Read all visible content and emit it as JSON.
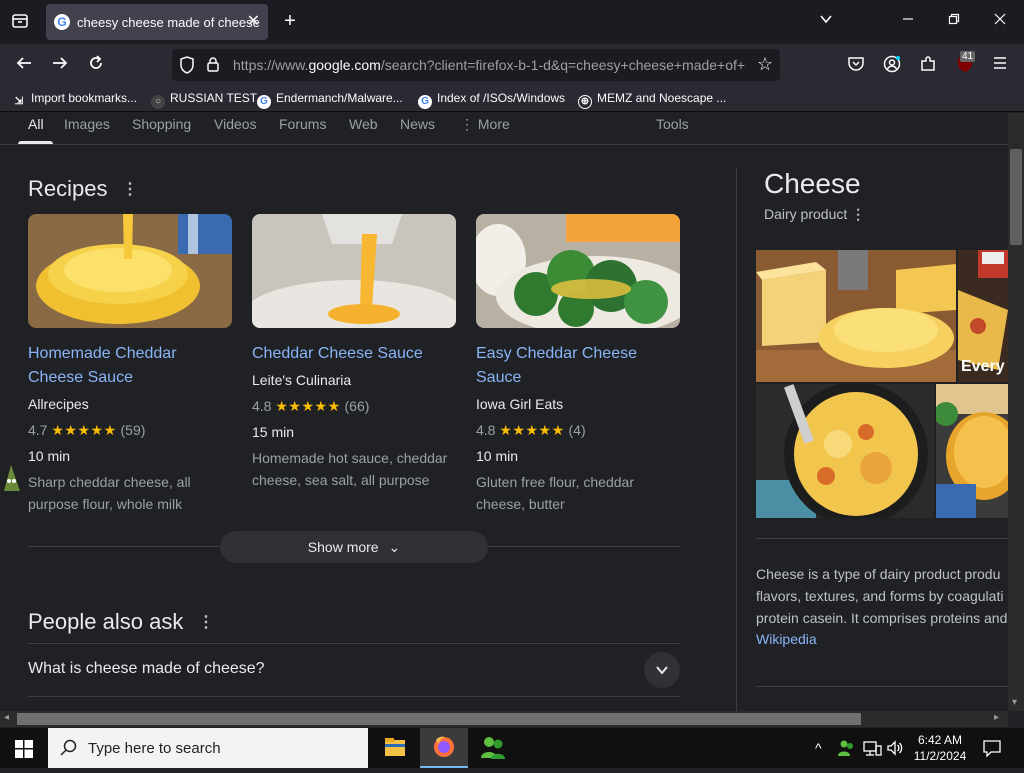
{
  "browser": {
    "tab_title": "cheesy cheese made of cheese",
    "url_prefix": "https://www.",
    "url_domain": "google.com",
    "url_rest": "/search?client=firefox-b-1-d&q=cheesy+cheese+made+of+",
    "badge_count": "41",
    "bookmarks": [
      "Import bookmarks...",
      "RUSSIAN TEST",
      "Endermanch/Malware...",
      "Index of /ISOs/Windows",
      "MEMZ and Noescape ..."
    ]
  },
  "search_nav": {
    "tabs": [
      "All",
      "Images",
      "Shopping",
      "Videos",
      "Forums",
      "Web",
      "News",
      "More"
    ],
    "tools": "Tools"
  },
  "recipes": {
    "heading": "Recipes",
    "cards": [
      {
        "title_line1": "Homemade Cheddar",
        "title_line2": "Cheese Sauce",
        "source": "Allrecipes",
        "rating": "4.7",
        "stars": "★★★★★",
        "count": "(59)",
        "time": "10 min",
        "desc_line1": "Sharp cheddar cheese, all",
        "desc_line2": "purpose flour, whole milk"
      },
      {
        "title_line1": "Cheddar Cheese Sauce",
        "title_line2": "",
        "source": "Leite's Culinaria",
        "rating": "4.8",
        "stars": "★★★★★",
        "count": "(66)",
        "time": "15 min",
        "desc_line1": "Homemade hot sauce, cheddar",
        "desc_line2": "cheese, sea salt, all purpose"
      },
      {
        "title_line1": "Easy Cheddar Cheese",
        "title_line2": "Sauce",
        "source": "Iowa Girl Eats",
        "rating": "4.8",
        "stars": "★★★★★",
        "count": "(4)",
        "time": "10 min",
        "desc_line1": "Gluten free flour, cheddar",
        "desc_line2": "cheese, butter"
      }
    ],
    "show_more": "Show more"
  },
  "people_also_ask": {
    "heading": "People also ask",
    "questions": [
      "What is cheese made of cheese?"
    ]
  },
  "knowledge_panel": {
    "title": "Cheese",
    "subtitle": "Dairy product",
    "image_caption": "Every",
    "desc_line1": "Cheese is a type of dairy product produ",
    "desc_line2": "flavors, textures, and forms by coagulati",
    "desc_line3": "protein casein. It comprises proteins and",
    "wiki_link": "Wikipedia"
  },
  "taskbar": {
    "search_placeholder": "Type here to search",
    "time": "6:42 AM",
    "date": "11/2/2024"
  }
}
